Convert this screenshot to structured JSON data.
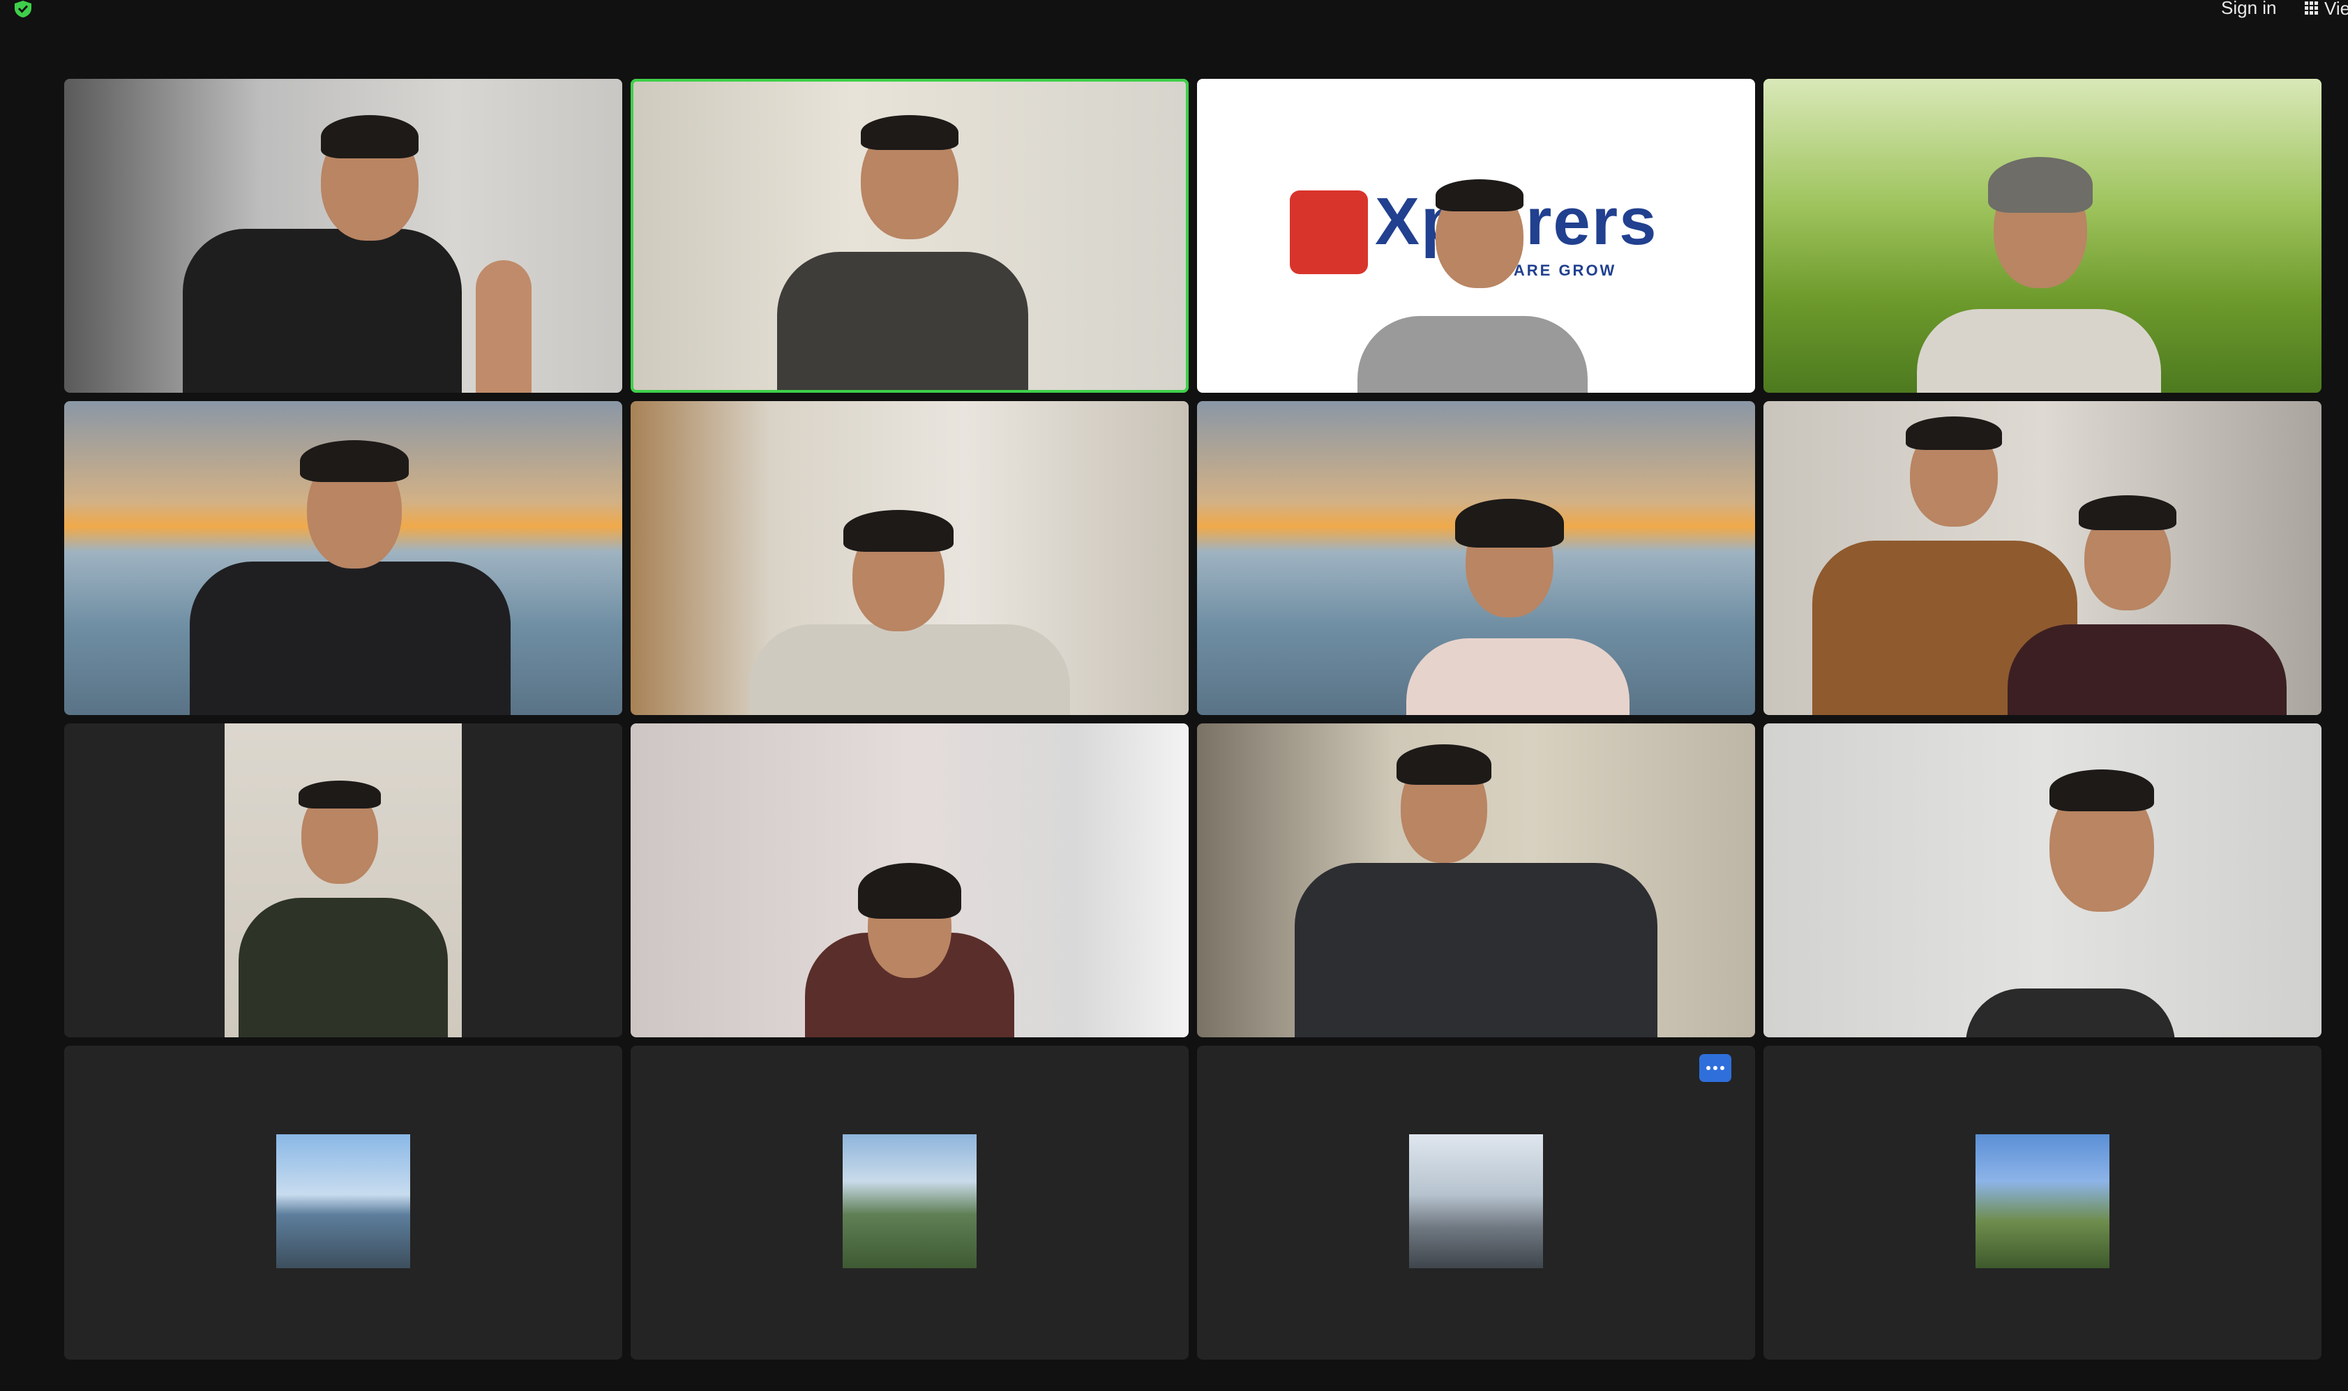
{
  "topbar": {
    "signin_label": "Sign in",
    "view_label": "Vie"
  },
  "colors": {
    "background": "#111111",
    "tile": "#242424",
    "active_speaker": "#3fcf4a",
    "more_button": "#2f6fdb",
    "shield": "#3fcf4a"
  },
  "icons": {
    "security": "shield-check-icon",
    "view": "grid-view-icon",
    "more": "more-options-icon"
  },
  "tiles": [
    {
      "name": "participant-video-1"
    },
    {
      "name": "participant-video-2",
      "active_speaker": true
    },
    {
      "name": "participant-video-3",
      "logo_text": "Xplorers",
      "logo_subtitle": "HARE GROW"
    },
    {
      "name": "participant-video-4"
    },
    {
      "name": "participant-video-5"
    },
    {
      "name": "participant-video-6"
    },
    {
      "name": "participant-video-7"
    },
    {
      "name": "participant-video-8"
    },
    {
      "name": "participant-video-9"
    },
    {
      "name": "participant-video-10"
    },
    {
      "name": "participant-video-11"
    },
    {
      "name": "participant-video-12"
    },
    {
      "name": "participant-avatar-13"
    },
    {
      "name": "participant-avatar-14"
    },
    {
      "name": "participant-avatar-15"
    },
    {
      "name": "participant-avatar-16"
    }
  ]
}
